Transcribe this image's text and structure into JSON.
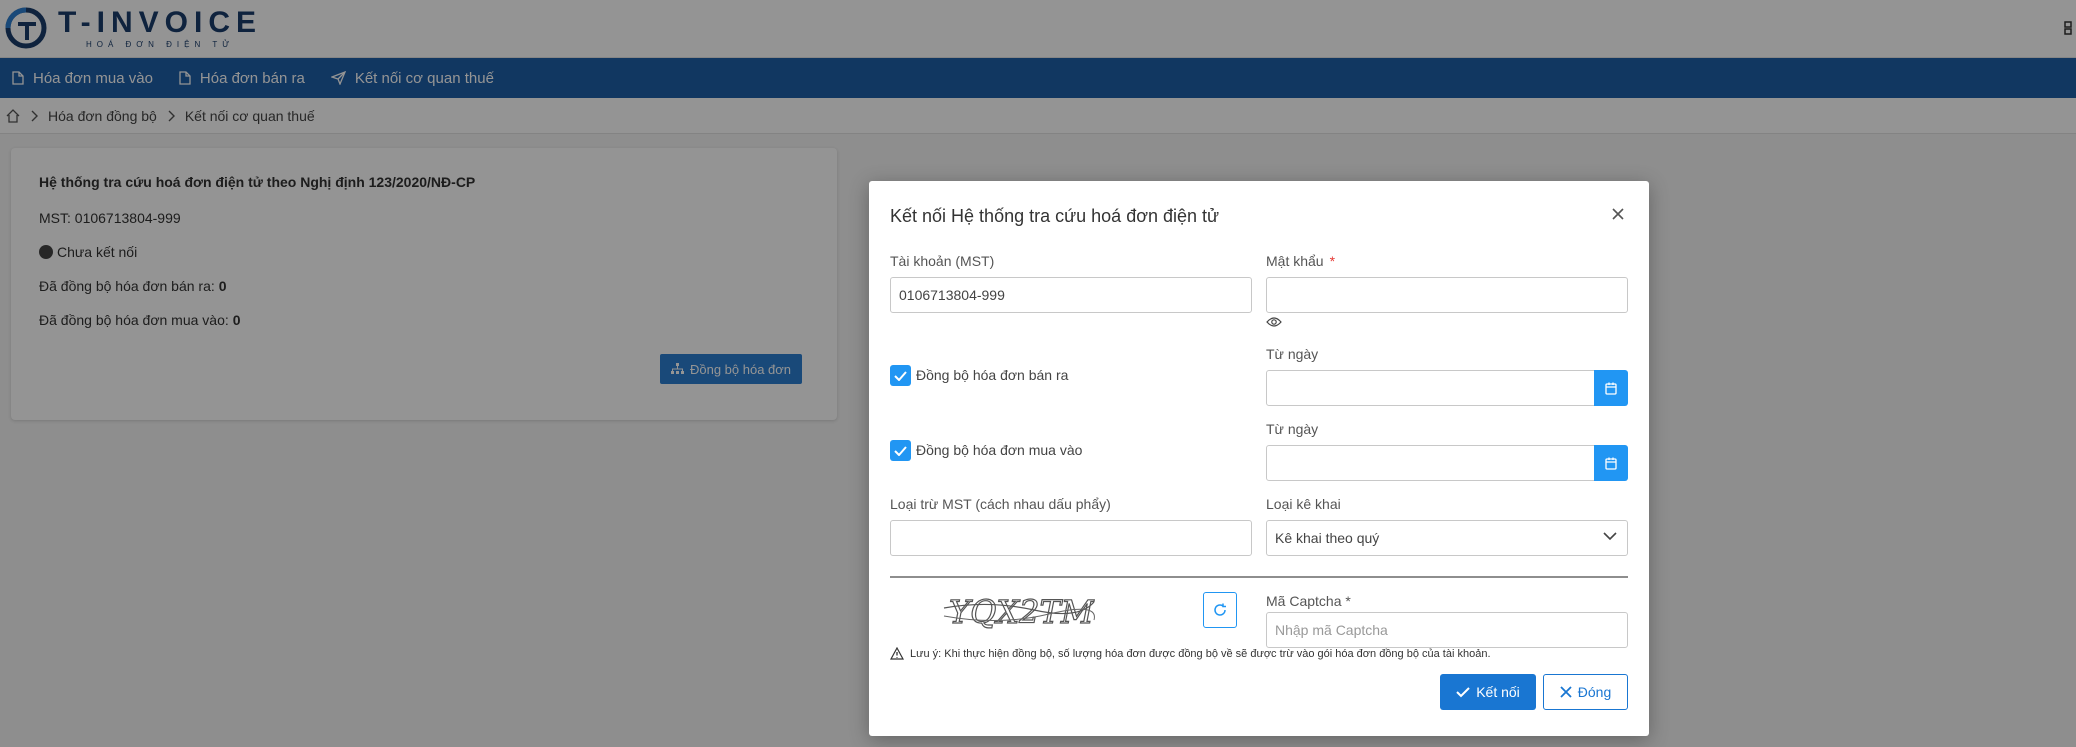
{
  "brand": {
    "title": "T-INVOICE",
    "subtitle": "HOÁ ĐƠN ĐIỆN TỬ"
  },
  "nav": [
    {
      "label": "Hóa đơn mua vào",
      "icon": "file-icon"
    },
    {
      "label": "Hóa đơn bán ra",
      "icon": "file-icon"
    },
    {
      "label": "Kết nối cơ quan thuế",
      "icon": "send-icon"
    }
  ],
  "breadcrumb": {
    "items": [
      "Hóa đơn đồng bộ",
      "Kết nối cơ quan thuế"
    ]
  },
  "card": {
    "title": "Hệ thống tra cứu hoá đơn điện tử theo Nghị định 123/2020/NĐ-CP",
    "mst_label": "MST: 0106713804-999",
    "status": "Chưa kết nối",
    "synced_sales_label": "Đã đồng bộ hóa đơn bán ra:",
    "synced_sales_value": "0",
    "synced_purchase_label": "Đã đồng bộ hóa đơn mua vào:",
    "synced_purchase_value": "0",
    "sync_button": "Đồng bộ hóa đơn"
  },
  "modal": {
    "title": "Kết nối Hệ thống tra cứu hoá đơn điện tử",
    "account_label": "Tài khoản (MST)",
    "account_value": "0106713804-999",
    "password_label": "Mật khẩu",
    "password_required": "*",
    "sync_sales_label": "Đồng bộ hóa đơn bán ra",
    "sync_sales_checked": true,
    "from_date_label_1": "Từ ngày",
    "sync_purchase_label": "Đồng bộ hóa đơn mua vào",
    "sync_purchase_checked": true,
    "from_date_label_2": "Từ ngày",
    "exclude_mst_label": "Loại trừ MST (cách nhau dấu phẩy)",
    "declaration_label": "Loại kê khai",
    "declaration_value": "Kê khai theo quý",
    "captcha_text": "YQX2TM",
    "captcha_label": "Mã Captcha *",
    "captcha_placeholder": "Nhập mã Captcha",
    "note": "Lưu ý: Khi thực hiện đồng bộ, số lượng hóa đơn được đồng bộ về sẽ được trừ vào gói hóa đơn đồng bộ của tài khoản.",
    "connect_button": "Kết nối",
    "close_button": "Đóng"
  },
  "colors": {
    "navbar": "#1e5fa8",
    "primary": "#2196f3",
    "button_primary": "#1976d2",
    "brand_text": "#1b3d6b"
  }
}
